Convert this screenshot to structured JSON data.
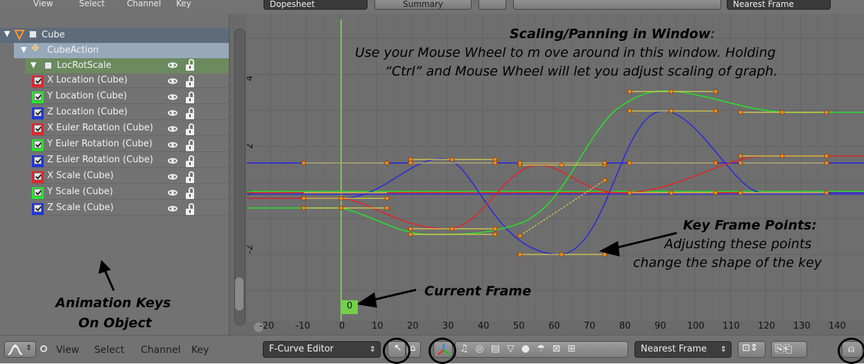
{
  "top_header": {
    "menus": [
      "View",
      "Select",
      "Channel",
      "Key"
    ],
    "mode": "Dopesheet",
    "summary": "Summary",
    "snap": "Nearest Frame"
  },
  "channels": {
    "object": "Cube",
    "action": "CubeAction",
    "group": "LocRotScale",
    "curves": [
      {
        "label": "X Location (Cube)",
        "color": "#e8242b"
      },
      {
        "label": "Y Location (Cube)",
        "color": "#22e82c"
      },
      {
        "label": "Z Location (Cube)",
        "color": "#2133e0"
      },
      {
        "label": "X Euler Rotation (Cube)",
        "color": "#e8242b"
      },
      {
        "label": "Y Euler Rotation (Cube)",
        "color": "#22e82c"
      },
      {
        "label": "Z Euler Rotation (Cube)",
        "color": "#2133e0"
      },
      {
        "label": "X Scale (Cube)",
        "color": "#e8242b"
      },
      {
        "label": "Y Scale (Cube)",
        "color": "#22e82c"
      },
      {
        "label": "Z Scale (Cube)",
        "color": "#2133e0"
      }
    ]
  },
  "graph": {
    "y_ticks": [
      "4",
      "2",
      "0",
      "-2"
    ],
    "x_ticks": [
      "-20",
      "-10",
      "0",
      "10",
      "20",
      "30",
      "40",
      "50",
      "60",
      "70",
      "80",
      "90",
      "100",
      "110",
      "120",
      "130",
      "140"
    ],
    "current_frame": "0"
  },
  "annotations": {
    "scaling_title": "Scaling/Panning in Window",
    "scaling_colon": ":",
    "scaling_line1": "Use your Mouse Wheel to m ove around in this window.  Holding",
    "scaling_line2": "“Ctrl” and Mouse Wheel will let you adjust scaling of graph.",
    "keyframe_title": "Key Frame Points:",
    "keyframe_line1": "Adjusting these points",
    "keyframe_line2": "change the shape of the key",
    "current_frame": "Current Frame",
    "anim_keys_line1": "Animation Keys",
    "anim_keys_line2": "On Object"
  },
  "bottom_header": {
    "menus": [
      "View",
      "Select",
      "Channel",
      "Key"
    ],
    "editor_mode": "F-Curve Editor",
    "snap": "Nearest Frame"
  },
  "colors": {
    "red_curve": "#e02626",
    "green_curve": "#28e028",
    "blue_curve": "#2b2bd8",
    "handle": "#e0c64a",
    "current_frame_line": "#74d04a"
  }
}
